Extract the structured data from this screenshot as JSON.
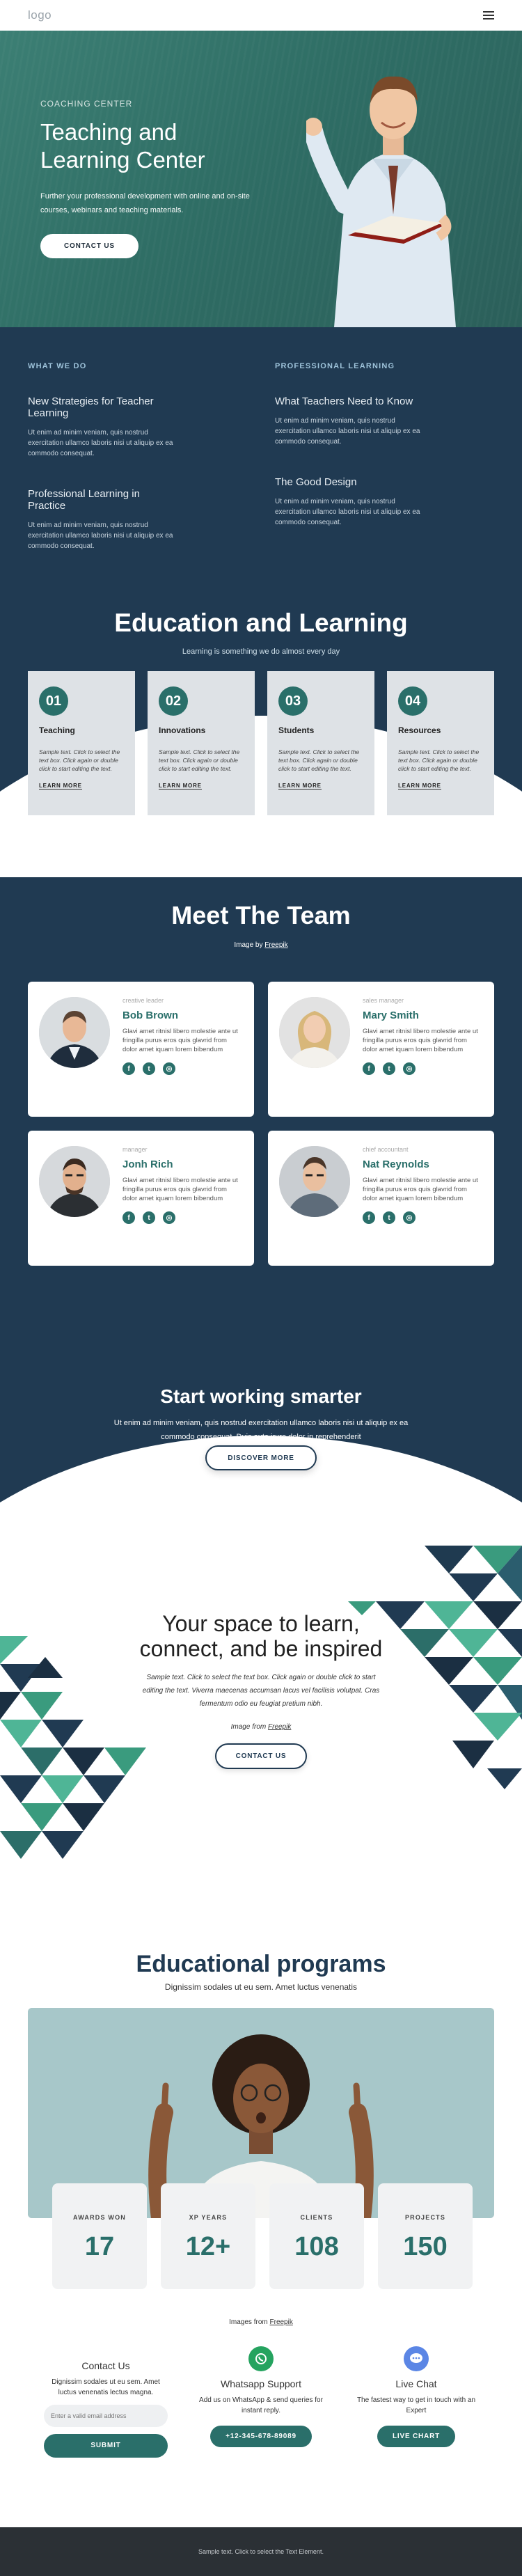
{
  "header": {
    "logo": "logo"
  },
  "hero": {
    "kicker": "COACHING CENTER",
    "title": "Teaching and Learning Center",
    "desc": "Further your professional development with online and on-site courses, webinars and teaching materials.",
    "button": "CONTACT US"
  },
  "whatwedo": {
    "left_head": "WHAT WE DO",
    "right_head": "PROFESSIONAL LEARNING",
    "items": [
      {
        "title": "New Strategies for Teacher Learning",
        "text": "Ut enim ad minim veniam, quis nostrud exercitation ullamco laboris nisi ut aliquip ex ea commodo consequat."
      },
      {
        "title": "What Teachers Need to Know",
        "text": "Ut enim ad minim veniam, quis nostrud exercitation ullamco laboris nisi ut aliquip ex ea commodo consequat."
      },
      {
        "title": "Professional Learning in Practice",
        "text": "Ut enim ad minim veniam, quis nostrud exercitation ullamco laboris nisi ut aliquip ex ea commodo consequat."
      },
      {
        "title": "The Good Design",
        "text": "Ut enim ad minim veniam, quis nostrud exercitation ullamco laboris nisi ut aliquip ex ea commodo consequat."
      }
    ]
  },
  "edu": {
    "title": "Education and Learning",
    "sub": "Learning is something we do almost every day",
    "cards": [
      {
        "num": "01",
        "title": "Teaching",
        "text": "Sample text. Click to select the text box. Click again or double click to start editing the text.",
        "link": "LEARN MORE"
      },
      {
        "num": "02",
        "title": "Innovations",
        "text": "Sample text. Click to select the text box. Click again or double click to start editing the text.",
        "link": "LEARN MORE"
      },
      {
        "num": "03",
        "title": "Students",
        "text": "Sample text. Click to select the text box. Click again or double click to start editing the text.",
        "link": "LEARN MORE"
      },
      {
        "num": "04",
        "title": "Resources",
        "text": "Sample text. Click to select the text box. Click again or double click to start editing the text.",
        "link": "LEARN MORE"
      }
    ]
  },
  "team": {
    "title": "Meet The Team",
    "credit_prefix": "Image by",
    "credit_link": "Freepik",
    "members": [
      {
        "role": "creative leader",
        "name": "Bob Brown",
        "desc": "Glavi amet ritnisl libero molestie ante ut fringilla purus eros quis glavrid from dolor amet iquam lorem bibendum"
      },
      {
        "role": "sales manager",
        "name": "Mary Smith",
        "desc": "Glavi amet ritnisl libero molestie ante ut fringilla purus eros quis glavrid from dolor amet iquam lorem bibendum"
      },
      {
        "role": "manager",
        "name": "Jonh Rich",
        "desc": "Glavi amet ritnisl libero molestie ante ut fringilla purus eros quis glavrid from dolor amet iquam lorem bibendum"
      },
      {
        "role": "chief accountant",
        "name": "Nat Reynolds",
        "desc": "Glavi amet ritnisl libero molestie ante ut fringilla purus eros quis glavrid from dolor amet iquam lorem bibendum"
      }
    ]
  },
  "smarter": {
    "title": "Start working smarter",
    "desc": "Ut enim ad minim veniam, quis nostrud exercitation ullamco laboris nisi ut aliquip ex ea commodo consequat. Duis aute irure dolor in reprehenderit",
    "button": "DISCOVER MORE"
  },
  "space": {
    "title": "Your space to learn, connect, and be inspired",
    "desc": "Sample text. Click to select the text box. Click again or double click to start editing the text. Viverra maecenas accumsan lacus vel facilisis volutpat.  Cras fermentum odio eu feugiat pretium nibh.",
    "credit_prefix": "Image from",
    "credit_link": "Freepik",
    "button": "CONTACT US"
  },
  "programs": {
    "title": "Educational programs",
    "sub": "Dignissim sodales ut eu sem. Amet luctus venenatis",
    "stats": [
      {
        "label": "AWARDS WON",
        "value": "17"
      },
      {
        "label": "XP YEARS",
        "value": "12+"
      },
      {
        "label": "CLIENTS",
        "value": "108"
      },
      {
        "label": "PROJECTS",
        "value": "150"
      }
    ],
    "credit_prefix": "Images from",
    "credit_link": "Freepik"
  },
  "contact": {
    "col1": {
      "title": "Contact Us",
      "text": "Dignissim sodales ut eu sem. Amet luctus venenatis lectus magna.",
      "placeholder": "Enter a valid email address",
      "button": "SUBMIT"
    },
    "col2": {
      "title": "Whatsapp Support",
      "text": "Add us on WhatsApp & send queries for instant reply.",
      "button": "+12-345-678-89089"
    },
    "col3": {
      "title": "Live Chat",
      "text": "The fastest way to get in touch with an Expert",
      "button": "LIVE CHART"
    }
  },
  "footer": {
    "text": "Sample text. Click to select the Text Element."
  },
  "colors": {
    "navy": "#203a52",
    "teal": "#2a6f6a",
    "hero_green": "#3c7f74"
  }
}
